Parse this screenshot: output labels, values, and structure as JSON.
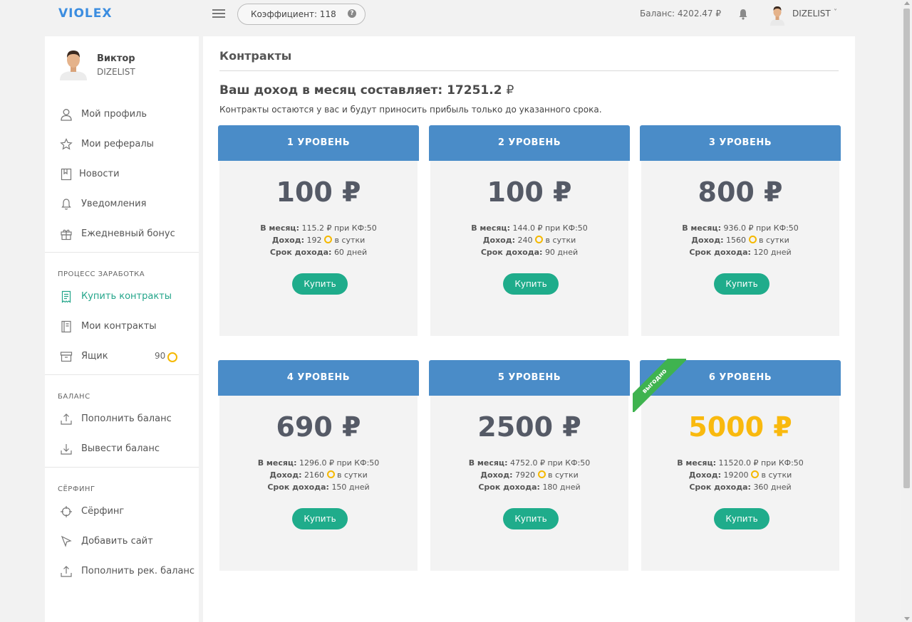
{
  "header": {
    "logo": "VIOLEX",
    "coefficient": "Коэффициент: 118",
    "help": "?",
    "balance": "Баланс: 4202.47 ₽",
    "username": "DIZELIST",
    "caret": "˅"
  },
  "sidebar": {
    "profile": {
      "name": "Виктор",
      "login": "DIZELIST"
    },
    "main_items": [
      {
        "label": "Мой профиль",
        "icon": "user-icon"
      },
      {
        "label": "Мои рефералы",
        "icon": "star-icon"
      },
      {
        "label": "Новости",
        "icon": "bookmark-icon"
      },
      {
        "label": "Уведомления",
        "icon": "bell-icon"
      },
      {
        "label": "Ежедневный бонус",
        "icon": "gift-icon"
      }
    ],
    "earning": {
      "title": "ПРОЦЕСС ЗАРАБОТКА",
      "items": [
        {
          "label": "Купить контракты",
          "icon": "receipt-icon",
          "active": true
        },
        {
          "label": "Мои контракты",
          "icon": "contracts-icon"
        },
        {
          "label": "Ящик",
          "icon": "box-icon",
          "count": "90"
        }
      ]
    },
    "balance": {
      "title": "БАЛАНС",
      "items": [
        {
          "label": "Пополнить баланс",
          "icon": "upload-icon"
        },
        {
          "label": "Вывести баланс",
          "icon": "download-icon"
        }
      ]
    },
    "surfing": {
      "title": "СЁРФИНГ",
      "items": [
        {
          "label": "Сёрфинг",
          "icon": "crosshair-icon"
        },
        {
          "label": "Добавить сайт",
          "icon": "cursor-icon"
        },
        {
          "label": "Пополнить рек. баланс",
          "icon": "upload-icon"
        }
      ]
    }
  },
  "main": {
    "title": "Контракты",
    "income_label": "Ваш доход в месяц составляет: 17251.2",
    "income_currency": "₽",
    "note": "Контракты остаются у вас и будут приносить прибыль только до указанного срока.",
    "labels": {
      "per_month": "В месяц:",
      "income": "Доход:",
      "term": "Срок дохода:",
      "per_day": "в сутки",
      "buy": "Купить"
    },
    "cards": [
      {
        "level": "1 УРОВЕНЬ",
        "price": "100 ₽",
        "per_month": "115.2 ₽  при КФ:50",
        "income": "192",
        "term": "60 дней"
      },
      {
        "level": "2 УРОВЕНЬ",
        "price": "100 ₽",
        "per_month": "144.0 ₽  при КФ:50",
        "income": "240",
        "term": "90 дней"
      },
      {
        "level": "3 УРОВЕНЬ",
        "price": "800 ₽",
        "per_month": "936.0 ₽  при КФ:50",
        "income": "1560",
        "term": "120 дней"
      },
      {
        "level": "4 УРОВЕНЬ",
        "price": "690 ₽",
        "per_month": "1296.0 ₽  при КФ:50",
        "income": "2160",
        "term": "150 дней"
      },
      {
        "level": "5 УРОВЕНЬ",
        "price": "2500 ₽",
        "per_month": "4752.0 ₽  при КФ:50",
        "income": "7920",
        "term": "180 дней"
      },
      {
        "level": "6 УРОВЕНЬ",
        "price": "5000 ₽",
        "per_month": "11520.0 ₽  при КФ:50",
        "income": "19200",
        "term": "360 дней",
        "ribbon": "выгодно"
      }
    ]
  },
  "colors": {
    "brand": "#3b8de0",
    "card_header": "#4a8cc8",
    "button": "#1fac8b",
    "active_menu": "#23a58a",
    "coin": "#f5b800",
    "gold_price": "#f9b90e",
    "ribbon": "#3fb34f"
  }
}
